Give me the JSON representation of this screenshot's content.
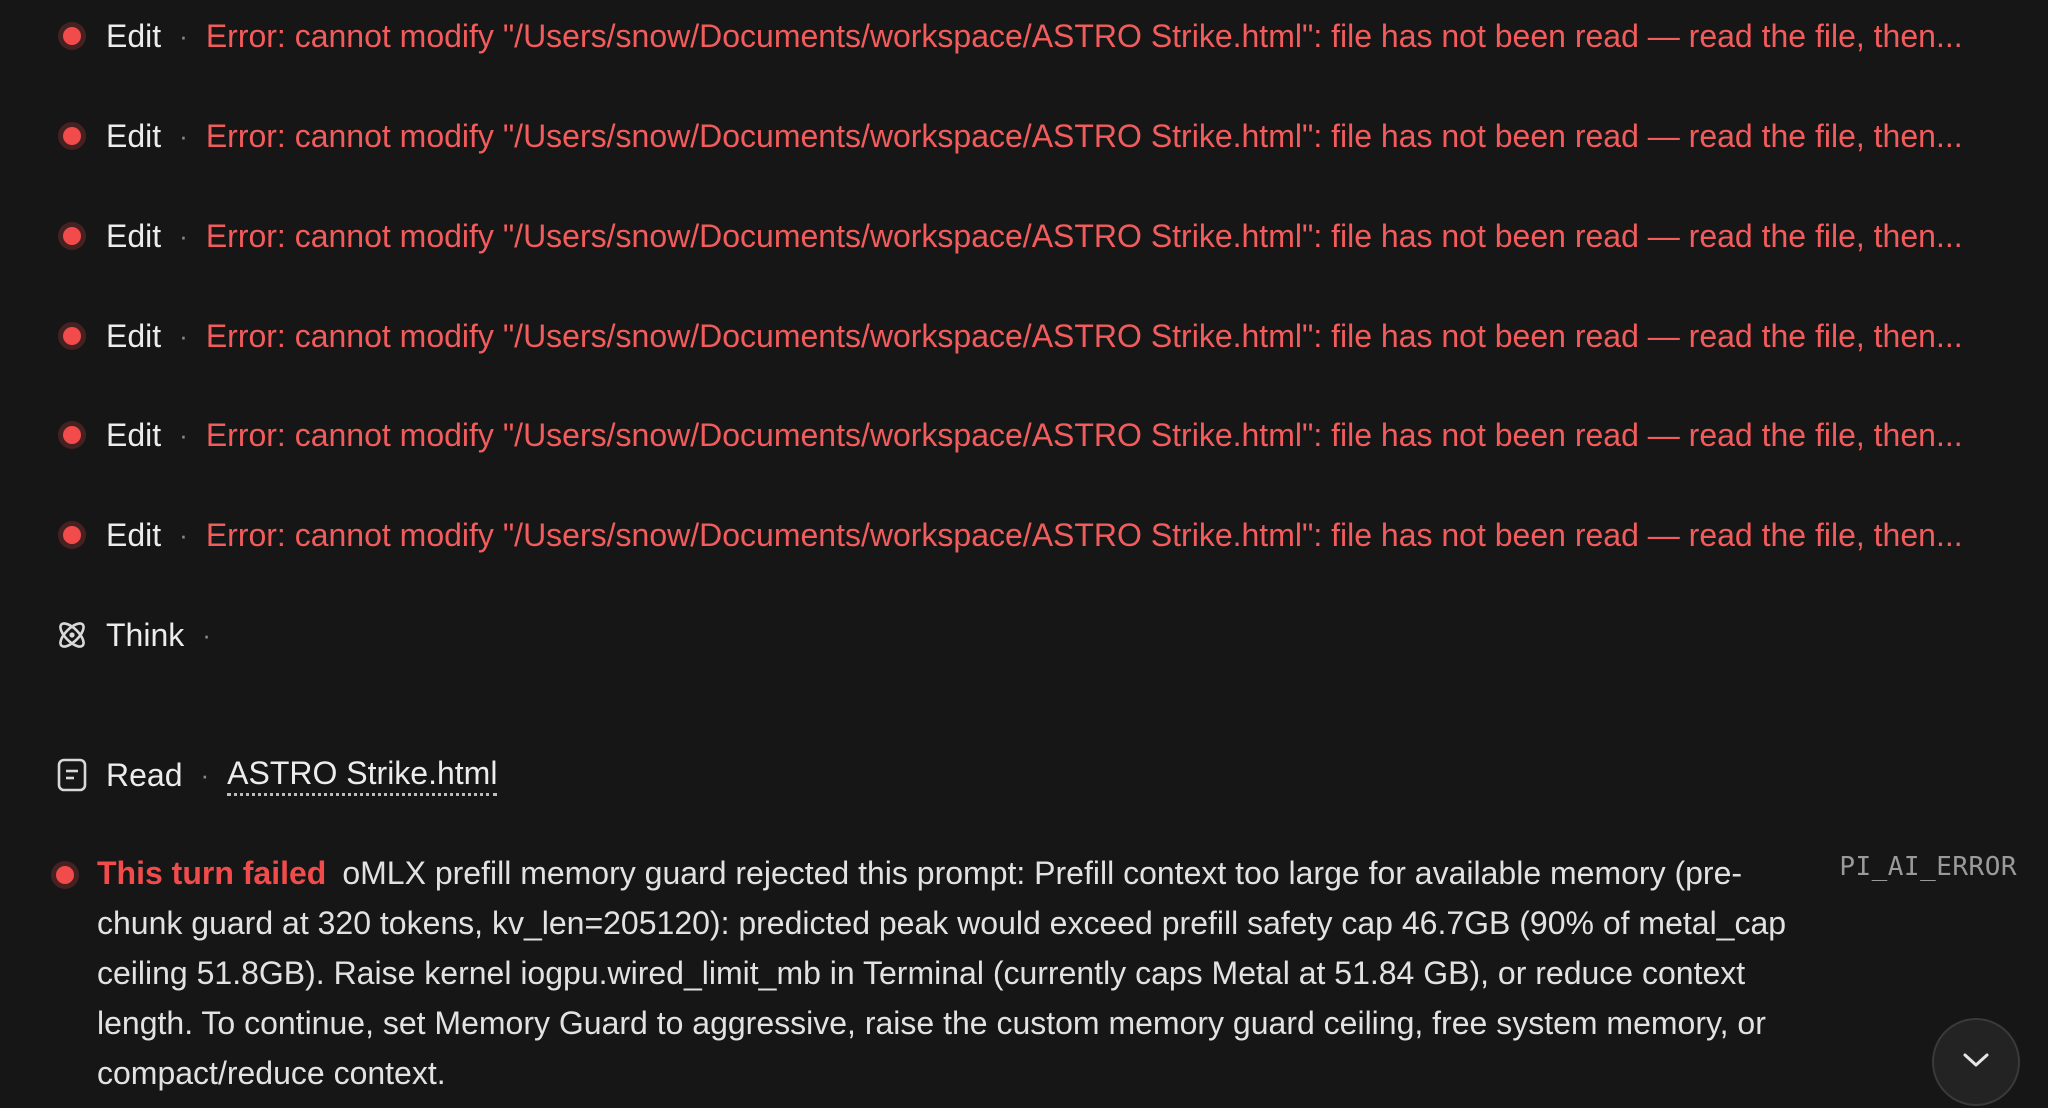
{
  "entries": [
    {
      "tool": "Edit",
      "sep": "·",
      "detail": "Error: cannot modify \"/Users/snow/Documents/workspace/ASTRO Strike.html\": file has not been read — read the file, then..."
    },
    {
      "tool": "Edit",
      "sep": "·",
      "detail": "Error: cannot modify \"/Users/snow/Documents/workspace/ASTRO Strike.html\": file has not been read — read the file, then..."
    },
    {
      "tool": "Edit",
      "sep": "·",
      "detail": "Error: cannot modify \"/Users/snow/Documents/workspace/ASTRO Strike.html\": file has not been read — read the file, then..."
    },
    {
      "tool": "Edit",
      "sep": "·",
      "detail": "Error: cannot modify \"/Users/snow/Documents/workspace/ASTRO Strike.html\": file has not been read — read the file, then..."
    },
    {
      "tool": "Edit",
      "sep": "·",
      "detail": "Error: cannot modify \"/Users/snow/Documents/workspace/ASTRO Strike.html\": file has not been read — read the file, then..."
    },
    {
      "tool": "Edit",
      "sep": "·",
      "detail": "Error: cannot modify \"/Users/snow/Documents/workspace/ASTRO Strike.html\": file has not been read — read the file, then..."
    }
  ],
  "think": {
    "label": "Think",
    "sep": "·",
    "icon": "atom-icon"
  },
  "read": {
    "label": "Read",
    "sep": "·",
    "file": "ASTRO Strike.html",
    "icon": "document-icon"
  },
  "failure": {
    "title": "This turn failed",
    "message": "oMLX prefill memory guard rejected this prompt: Prefill context too large for available memory (pre-chunk guard at 320 tokens, kv_len=205120): predicted peak would exceed prefill safety cap 46.7GB (90% of metal_cap ceiling 51.8GB). Raise kernel iogpu.wired_limit_mb in Terminal (currently caps Metal at 51.84 GB), or reduce context length. To continue, set Memory Guard to aggressive, raise the custom memory guard ceiling, free system memory, or compact/reduce context.",
    "code": "PI_AI_ERROR"
  },
  "scroll_button": {
    "icon": "chevron-down-icon"
  },
  "colors": {
    "background": "#161616",
    "error": "#f25c5c",
    "status_dot": "#f24b4b",
    "text": "#ececec"
  }
}
